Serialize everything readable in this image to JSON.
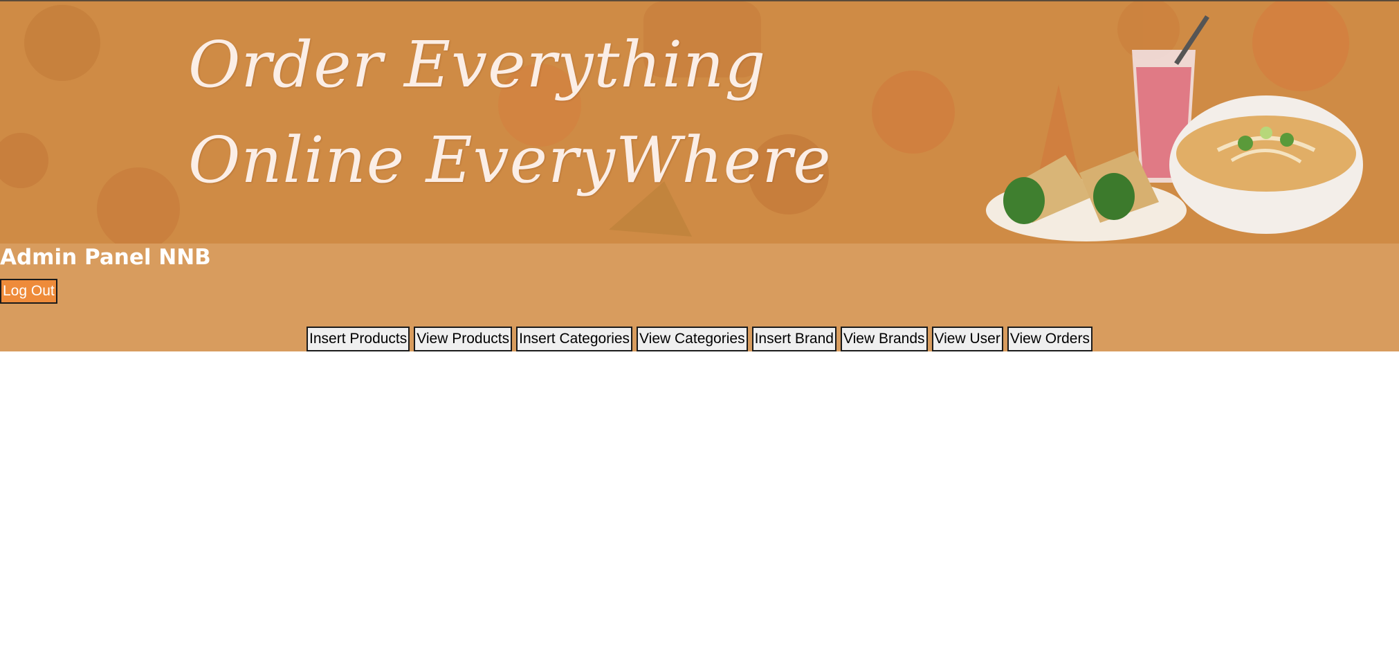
{
  "banner": {
    "line1": "Order Everything",
    "line2": "Online EveryWhere",
    "background_color": "#cf8b45"
  },
  "panel": {
    "title": "Admin Panel NNB",
    "background_color": "#d89c5e",
    "logout_label": "Log Out",
    "logout_color": "#ee8b3a"
  },
  "nav": {
    "buttons": [
      {
        "label": "Insert Products"
      },
      {
        "label": "View Products"
      },
      {
        "label": "Insert Categories"
      },
      {
        "label": "View Categories"
      },
      {
        "label": "Insert Brand"
      },
      {
        "label": "View Brands"
      },
      {
        "label": "View User"
      },
      {
        "label": "View Orders"
      }
    ]
  }
}
